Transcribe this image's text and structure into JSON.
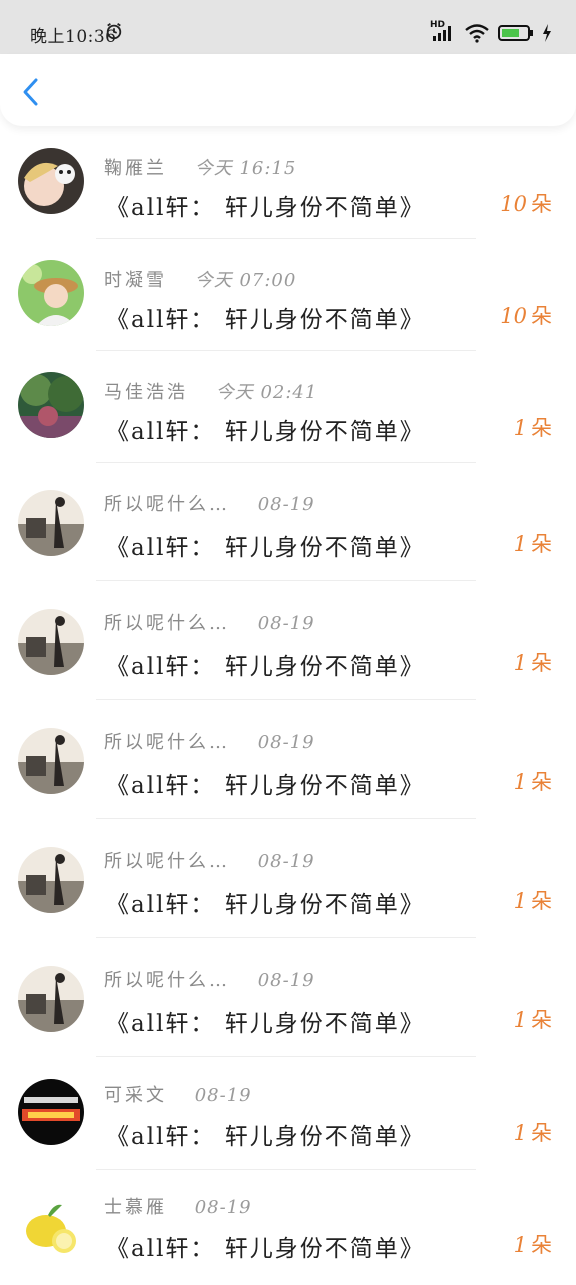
{
  "status_bar": {
    "time": "晚上10:36",
    "network": "HD"
  },
  "header": {
    "back_icon": "chevron-left-icon"
  },
  "colors": {
    "accent": "#2f8ff0",
    "count_color": "#e98237"
  },
  "gift_records": [
    {
      "name": "鞠雁兰",
      "time": "今天 16:15",
      "gift": "《all轩： 轩儿身份不简单》",
      "count": "10",
      "unit": "朵"
    },
    {
      "name": "时凝雪",
      "time": "今天 07:00",
      "gift": "《all轩： 轩儿身份不简单》",
      "count": "10",
      "unit": "朵"
    },
    {
      "name": "马佳浩浩",
      "time": "今天 02:41",
      "gift": "《all轩： 轩儿身份不简单》",
      "count": "1",
      "unit": "朵"
    },
    {
      "name": "所以呢什么…",
      "time": "08-19",
      "gift": "《all轩： 轩儿身份不简单》",
      "count": "1",
      "unit": "朵"
    },
    {
      "name": "所以呢什么…",
      "time": "08-19",
      "gift": "《all轩： 轩儿身份不简单》",
      "count": "1",
      "unit": "朵"
    },
    {
      "name": "所以呢什么…",
      "time": "08-19",
      "gift": "《all轩： 轩儿身份不简单》",
      "count": "1",
      "unit": "朵"
    },
    {
      "name": "所以呢什么…",
      "time": "08-19",
      "gift": "《all轩： 轩儿身份不简单》",
      "count": "1",
      "unit": "朵"
    },
    {
      "name": "所以呢什么…",
      "time": "08-19",
      "gift": "《all轩： 轩儿身份不简单》",
      "count": "1",
      "unit": "朵"
    },
    {
      "name": "可采文",
      "time": "08-19",
      "gift": "《all轩： 轩儿身份不简单》",
      "count": "1",
      "unit": "朵"
    },
    {
      "name": "士慕雁",
      "time": "08-19",
      "gift": "《all轩： 轩儿身份不简单》",
      "count": "1",
      "unit": "朵"
    }
  ]
}
